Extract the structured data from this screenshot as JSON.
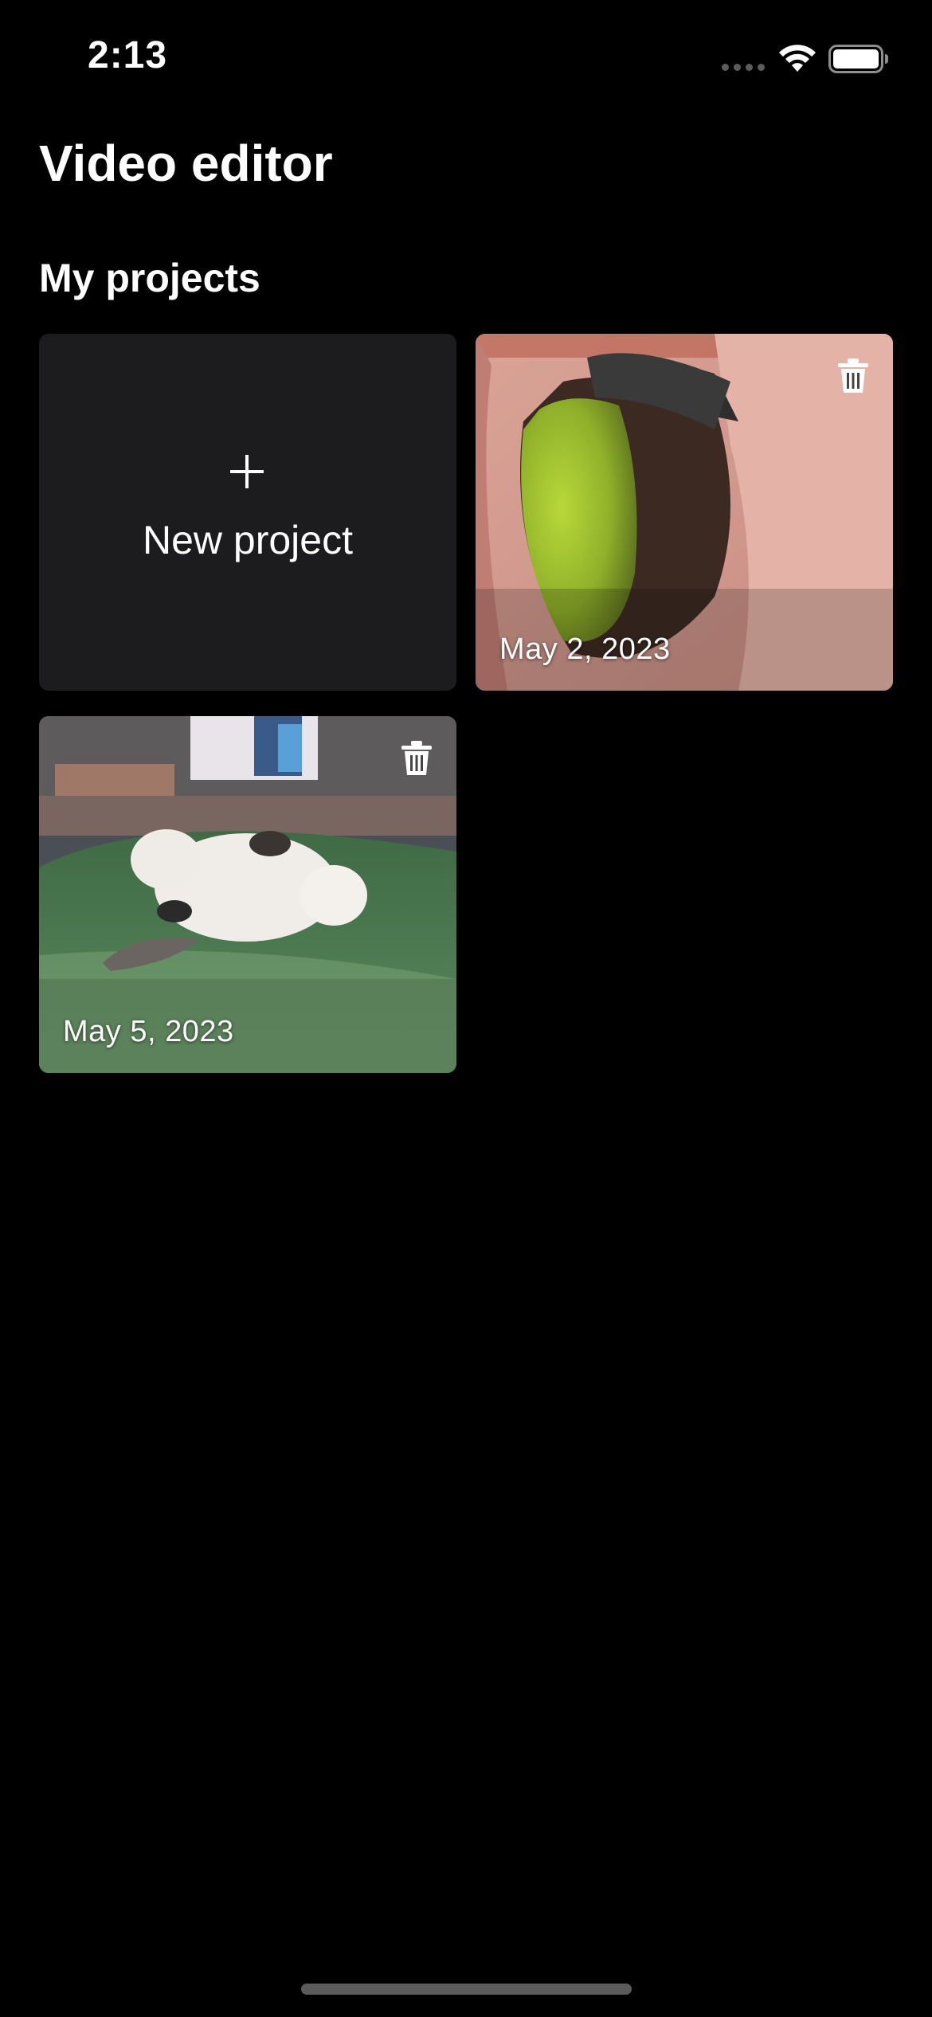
{
  "status_bar": {
    "time": "2:13",
    "icons": [
      "signal-dots-icon",
      "wifi-icon",
      "battery-icon"
    ]
  },
  "page": {
    "title": "Video editor",
    "section_title": "My projects"
  },
  "new_project": {
    "icon": "plus-icon",
    "label": "New project"
  },
  "projects": [
    {
      "date": "May 2, 2023",
      "thumbnail": "avocado-in-hand",
      "action_icon": "trash-icon"
    },
    {
      "date": "May 5, 2023",
      "thumbnail": "cat-on-blanket",
      "action_icon": "trash-icon"
    }
  ],
  "colors": {
    "background": "#000000",
    "card_background": "#1c1c1e",
    "text": "#ffffff",
    "home_indicator": "#5b5b5b"
  }
}
